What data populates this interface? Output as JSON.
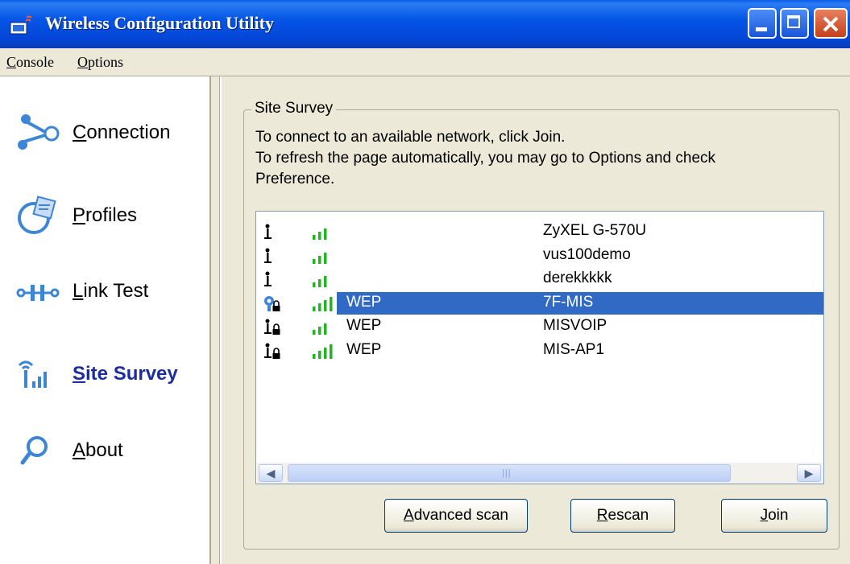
{
  "window": {
    "title": "Wireless Configuration Utility"
  },
  "menu": {
    "items": [
      "Console",
      "Options"
    ]
  },
  "sidebar": {
    "items": [
      {
        "label": "Connection",
        "icon": "connection-icon",
        "active": false
      },
      {
        "label": "Profiles",
        "icon": "profiles-icon",
        "active": false
      },
      {
        "label": "Link Test",
        "icon": "link-test-icon",
        "active": false
      },
      {
        "label": "Site Survey",
        "icon": "site-survey-icon",
        "active": true
      },
      {
        "label": "About",
        "icon": "about-icon",
        "active": false
      }
    ]
  },
  "site_survey": {
    "group_title": "Site Survey",
    "instructions": [
      "To connect to an available network, click Join.",
      "To refresh the page automatically, you may go to Options and check",
      "Preference."
    ],
    "networks": [
      {
        "security": "",
        "ssid": "ZyXEL G-570U",
        "icon": "access-point-icon",
        "signal_bars": 3,
        "selected": false
      },
      {
        "security": "",
        "ssid": "vus100demo",
        "icon": "access-point-icon",
        "signal_bars": 3,
        "selected": false
      },
      {
        "security": "",
        "ssid": "derekkkkk",
        "icon": "access-point-icon",
        "signal_bars": 3,
        "selected": false
      },
      {
        "security": "WEP",
        "ssid": "7F-MIS",
        "icon": "connected-lock-icon",
        "signal_bars": 4,
        "selected": true
      },
      {
        "security": "WEP",
        "ssid": "MISVOIP",
        "icon": "access-point-lock-icon",
        "signal_bars": 3,
        "selected": false
      },
      {
        "security": "WEP",
        "ssid": "MIS-AP1",
        "icon": "access-point-lock-icon",
        "signal_bars": 4,
        "selected": false
      }
    ],
    "buttons": {
      "advanced_scan": "Advanced scan",
      "rescan": "Rescan",
      "join": "Join"
    }
  },
  "colors": {
    "selection": "#316ac5",
    "signal": "#22b422",
    "titlebar": "#0555e6",
    "active_nav": "#1b2da0"
  }
}
